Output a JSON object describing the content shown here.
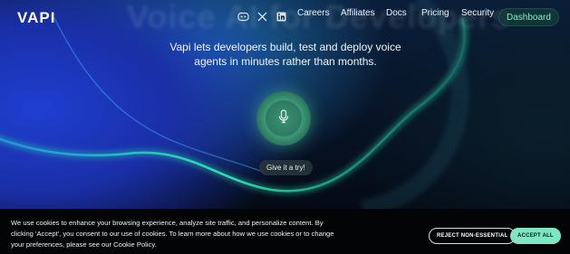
{
  "brand": {
    "logo": "VAPI",
    "ghost_title": "Voice AI for Developers"
  },
  "nav": {
    "icons": [
      "discord-icon",
      "x-icon",
      "linkedin-icon"
    ],
    "links": [
      "Careers",
      "Affiliates",
      "Docs",
      "Pricing",
      "Security"
    ],
    "dashboard": "Dashboard"
  },
  "hero": {
    "tagline": "Vapi lets developers build, test and deploy voice agents in minutes rather than months.",
    "mic_icon": "microphone-icon",
    "try_label": "Give it a try!"
  },
  "cookie": {
    "text": "We use cookies to enhance your browsing experience, analyze site traffic, and personalize content. By clicking 'Accept', you consent to our use of cookies. To learn more about how we use cookies or to change your preferences, please see our Cookie Policy.",
    "reject_label": "REJECT NON-ESSENTIAL",
    "accept_label": "ACCEPT ALL"
  },
  "colors": {
    "accent": "#7fe6c4",
    "dashboard_text": "#7ff0c8",
    "hero_blue": "#1f3fd0",
    "wave_green": "#2de0b0"
  }
}
